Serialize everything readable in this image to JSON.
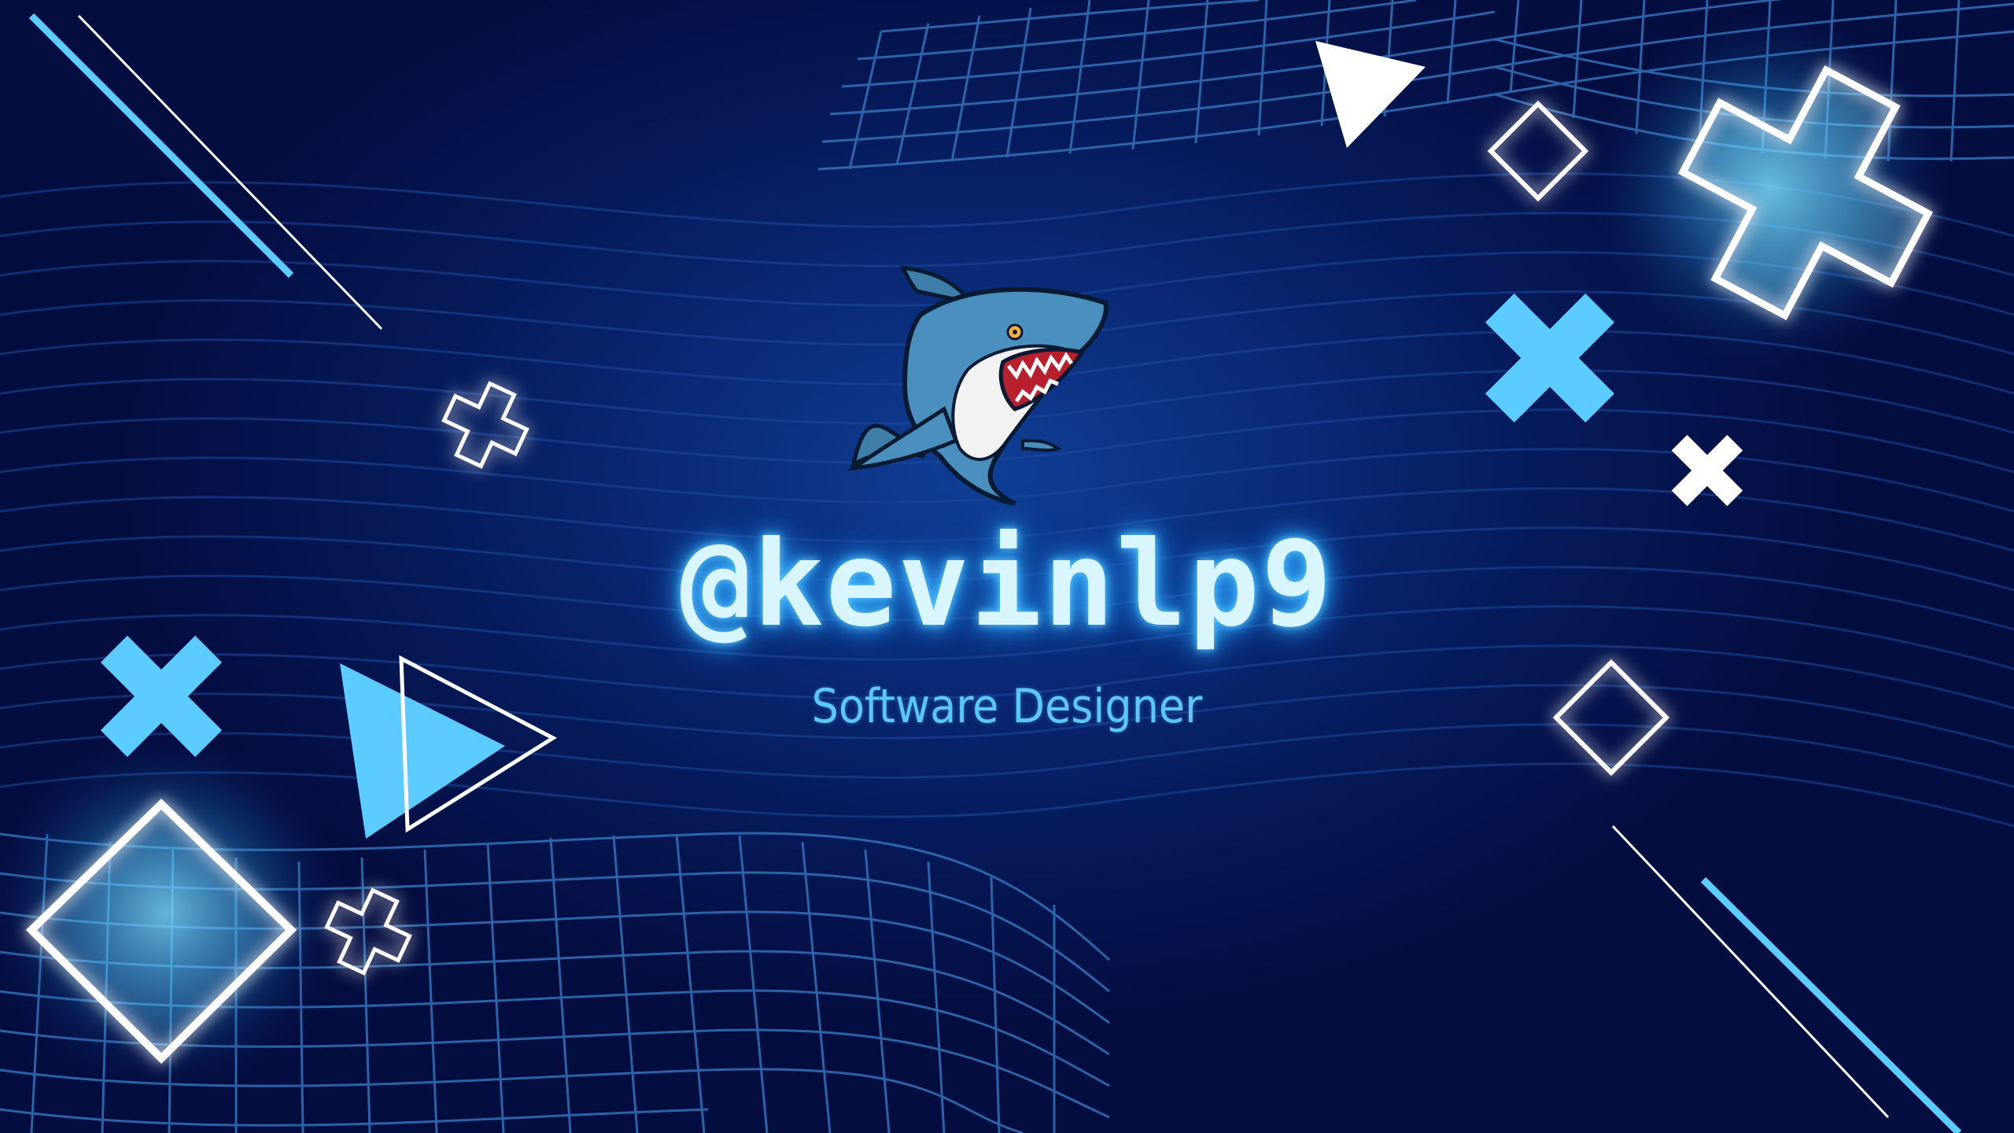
{
  "profile": {
    "handle": "@kevinlp9",
    "role": "Software Designer"
  },
  "icons": {
    "mascot": "shark-mascot-icon"
  },
  "colors": {
    "background_deep": "#040d40",
    "background_mid": "#0a2a78",
    "accent_cyan": "#5ccbff",
    "grid_line": "#3a7fc8",
    "text_glow": "#d9f6ff",
    "subtitle": "#5cc6f5"
  }
}
